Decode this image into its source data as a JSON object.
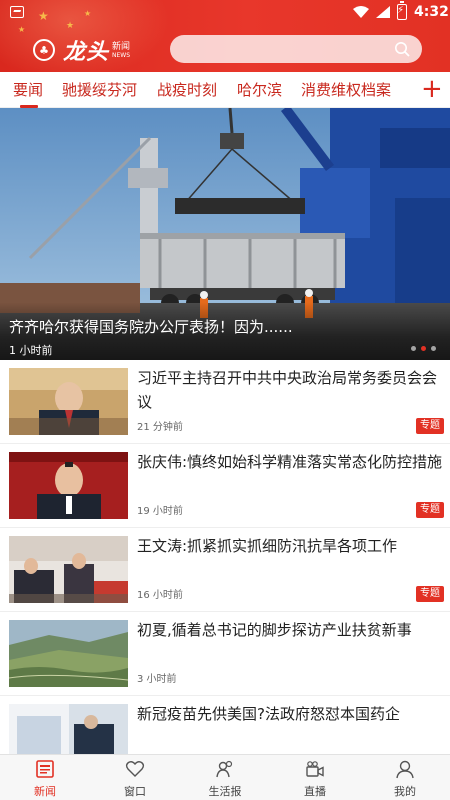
{
  "status_bar": {
    "time": "4:32"
  },
  "header": {
    "app_name": "龙头",
    "app_sub_cn": "新闻",
    "app_sub_en": "NEWS",
    "search_placeholder": ""
  },
  "tabs": [
    {
      "label": "要闻",
      "active": true
    },
    {
      "label": "驰援绥芬河",
      "active": false
    },
    {
      "label": "战疫时刻",
      "active": false
    },
    {
      "label": "哈尔滨",
      "active": false
    },
    {
      "label": "消费维权档案",
      "active": false
    }
  ],
  "tab_add_label": "+",
  "hero": {
    "title": "齐齐哈尔获得国务院办公厅表扬！因为......",
    "time": "1 小时前",
    "slides": 3,
    "active_slide": 2
  },
  "news": [
    {
      "headline": "习近平主持召开中共中央政治局常务委员会会议",
      "time": "21 分钟前",
      "badge": "专题"
    },
    {
      "headline": "张庆伟:慎终如始科学精准落实常态化防控措施",
      "time": "19 小时前",
      "badge": "专题"
    },
    {
      "headline": "王文涛:抓紧抓实抓细防汛抗旱各项工作",
      "time": "16 小时前",
      "badge": "专题"
    },
    {
      "headline": "初夏,循着总书记的脚步探访产业扶贫新事",
      "time": "3 小时前",
      "badge": ""
    },
    {
      "headline": "新冠疫苗先供美国?法政府怒怼本国药企",
      "time": "",
      "badge": ""
    }
  ],
  "bottom_nav": [
    {
      "label": "新闻",
      "icon": "news-icon",
      "active": true
    },
    {
      "label": "窗口",
      "icon": "heart-icon",
      "active": false
    },
    {
      "label": "生活报",
      "icon": "people-icon",
      "active": false
    },
    {
      "label": "直播",
      "icon": "video-camera-icon",
      "active": false
    },
    {
      "label": "我的",
      "icon": "user-icon",
      "active": false
    }
  ],
  "colors": {
    "brand_red": "#e23124",
    "tab_text": "#c8281e"
  }
}
